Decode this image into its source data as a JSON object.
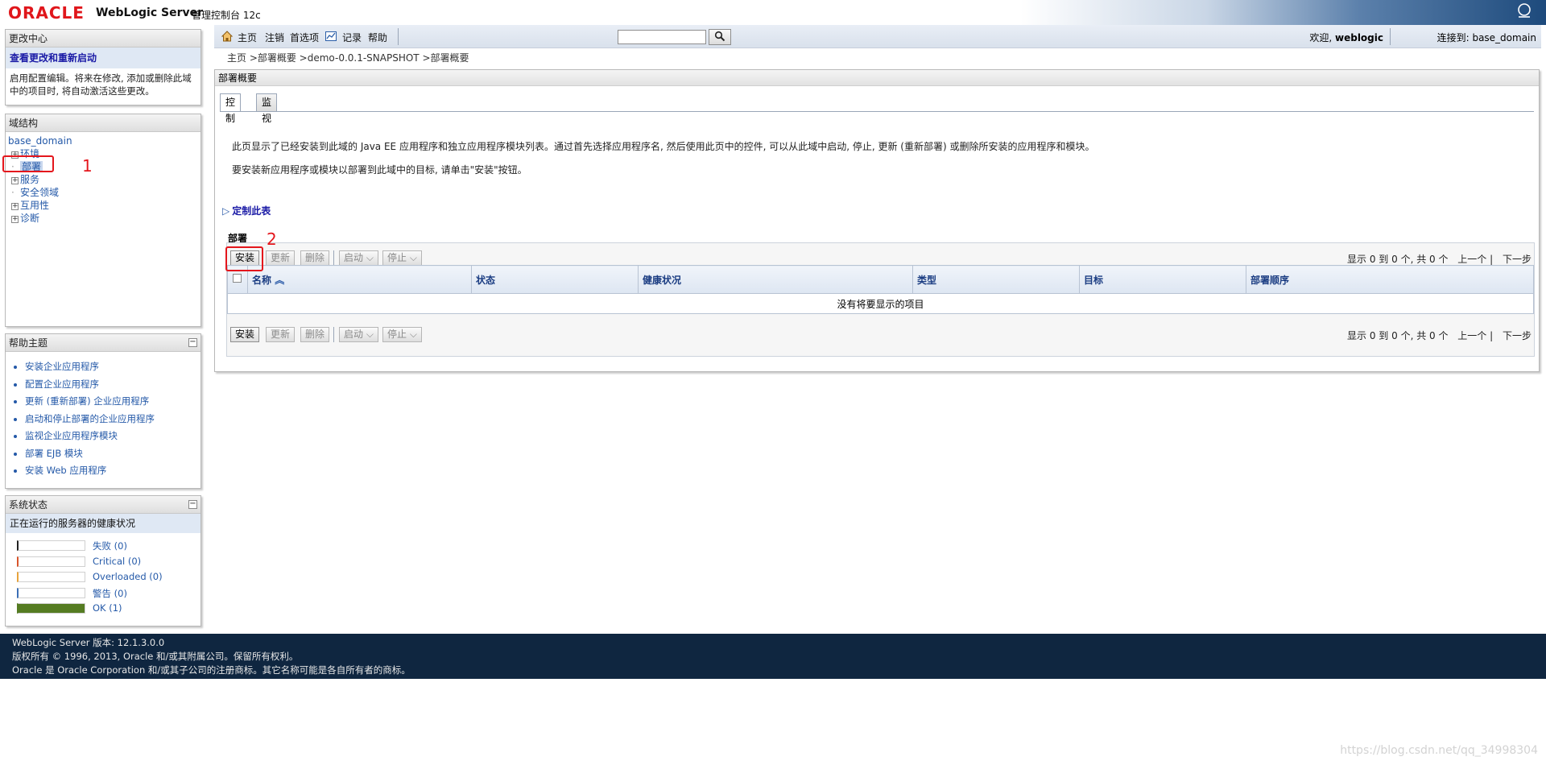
{
  "header": {
    "brand": "ORACLE",
    "product": "WebLogic Server",
    "product_sub": "管理控制台 12c"
  },
  "toolbar": {
    "home": "主页",
    "logout": "注销",
    "preferences": "首选项",
    "record": "记录",
    "help": "帮助",
    "search_value": "",
    "welcome_prefix": "欢迎,",
    "welcome_user": "weblogic",
    "connected_prefix": "连接到:",
    "connected_domain": "base_domain"
  },
  "breadcrumb": "主页 >部署概要 >demo-0.0.1-SNAPSHOT >部署概要",
  "change_center": {
    "title": "更改中心",
    "link": "查看更改和重新启动",
    "text": "启用配置编辑。将来在修改, 添加或删除此域中的项目时, 将自动激活这些更改。"
  },
  "domain_structure": {
    "title": "域结构",
    "root": "base_domain",
    "items": [
      {
        "label": "环境",
        "expandable": true
      },
      {
        "label": "部署",
        "expandable": false
      },
      {
        "label": "服务",
        "expandable": true
      },
      {
        "label": "安全领域",
        "expandable": false
      },
      {
        "label": "互用性",
        "expandable": true
      },
      {
        "label": "诊断",
        "expandable": true
      }
    ]
  },
  "help_topics": {
    "title": "帮助主题",
    "items": [
      "安装企业应用程序",
      "配置企业应用程序",
      "更新 (重新部署) 企业应用程序",
      "启动和停止部署的企业应用程序",
      "监视企业应用程序模块",
      "部署 EJB 模块",
      "安装 Web 应用程序"
    ]
  },
  "system_status": {
    "title": "系统状态",
    "subtitle": "正在运行的服务器的健康状况",
    "rows": [
      {
        "label": "失败 (0)",
        "color": "#222222",
        "value": 0
      },
      {
        "label": "Critical (0)",
        "color": "#d9542b",
        "value": 0
      },
      {
        "label": "Overloaded (0)",
        "color": "#e8a33c",
        "value": 0
      },
      {
        "label": "警告 (0)",
        "color": "#3b6fb6",
        "value": 0
      },
      {
        "label": "OK (1)",
        "color": "#557c22",
        "value": 1
      }
    ]
  },
  "content": {
    "title": "部署概要",
    "tabs": [
      "控制",
      "监视"
    ],
    "intro1": "此页显示了已经安装到此域的 Java EE 应用程序和独立应用程序模块列表。通过首先选择应用程序名, 然后使用此页中的控件, 可以从此域中启动, 停止, 更新 (重新部署) 或删除所安装的应用程序和模块。",
    "intro2": "要安装新应用程序或模块以部署到此域中的目标, 请单击\"安装\"按钮。",
    "customize": "定制此表",
    "section_label": "部署",
    "buttons": {
      "install": "安装",
      "update": "更新",
      "delete": "删除",
      "start": "启动",
      "stop": "停止"
    },
    "pager": {
      "summary": "显示 0 到 0 个, 共 0 个",
      "prev": "上一个",
      "next": "下一步"
    },
    "columns": [
      "名称",
      "状态",
      "健康状况",
      "类型",
      "目标",
      "部署顺序"
    ],
    "empty_message": "没有将要显示的项目"
  },
  "annotations": [
    "1",
    "2"
  ],
  "footer": {
    "line1": "WebLogic Server 版本: 12.1.3.0.0",
    "line2": "版权所有 © 1996, 2013, Oracle 和/或其附属公司。保留所有权利。",
    "line3": "Oracle 是 Oracle Corporation 和/或其子公司的注册商标。其它名称可能是各自所有者的商标。"
  },
  "watermark": "https://blog.csdn.net/qq_34998304"
}
